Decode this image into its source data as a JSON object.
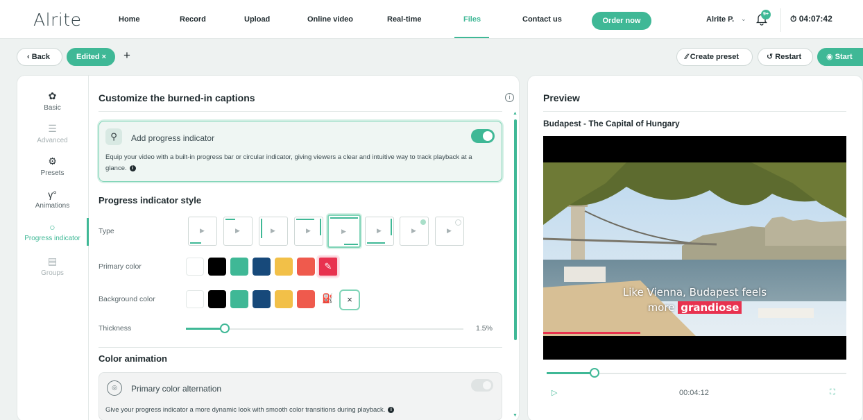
{
  "app": {
    "logo": "Alrite"
  },
  "nav": {
    "items": [
      "Home",
      "Record",
      "Upload",
      "Online video",
      "Real-time",
      "Files",
      "Contact us"
    ],
    "active": "Files",
    "order_label": "Order now",
    "user": "Alrite P.",
    "notifications": "9+",
    "timer": "04:07:42"
  },
  "toolbar": {
    "back_label": "Back",
    "edited_label": "Edited",
    "add_label": "+",
    "create_preset_label": "Create preset",
    "restart_label": "Restart",
    "start_label": "Start"
  },
  "sidebar": {
    "items": [
      {
        "label": "Basic",
        "icon": "palette-icon"
      },
      {
        "label": "Advanced",
        "icon": "sliders-icon"
      },
      {
        "label": "Presets",
        "icon": "gear-icon"
      },
      {
        "label": "Animations",
        "icon": "animation-icon"
      },
      {
        "label": "Progress indicator",
        "icon": "progress-indicator-icon"
      },
      {
        "label": "Groups",
        "icon": "groups-icon"
      }
    ],
    "active": "Progress indicator"
  },
  "main": {
    "title": "Customize the burned-in captions",
    "progress_card": {
      "title": "Add progress indicator",
      "enabled": true,
      "description": "Equip your video with a built-in progress bar or circular indicator, giving viewers a clear and intuitive way to track playback at a glance."
    },
    "style_section": {
      "title": "Progress indicator style",
      "type_label": "Type",
      "selected_type": 5,
      "primary_color_label": "Primary color",
      "background_color_label": "Background color",
      "thickness_label": "Thickness",
      "thickness_value": "1.5%",
      "thickness_fraction": 0.14
    },
    "animation_section": {
      "title": "Color animation",
      "card_title": "Primary color alternation",
      "enabled": false,
      "description": "Give your progress indicator a more dynamic look with smooth color transitions during playback."
    }
  },
  "colors": {
    "accent": "#3fb896",
    "primary_swatches": [
      "#ffffff",
      "#000000",
      "#3fb896",
      "#17497a",
      "#f2c048",
      "#ef5a4d",
      "#e8324f"
    ],
    "background_swatches": [
      "#ffffff",
      "#000000",
      "#3fb896",
      "#17497a",
      "#f2c048",
      "#ef5a4d"
    ]
  },
  "preview": {
    "title": "Preview",
    "video_title": "Budapest - The Capital of Hungary",
    "caption_line1": "Like Vienna, Budapest feels",
    "caption_line2_pre": "more",
    "caption_line2_hl": "grandiose",
    "time": "00:04:12",
    "progress_fraction": 0.16
  }
}
